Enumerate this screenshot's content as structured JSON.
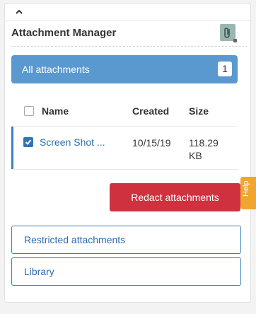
{
  "header": {
    "title": "Attachment Manager",
    "collapse_icon": "chevron-up-icon",
    "attach_icon": "paperclip-icon"
  },
  "all_attachments": {
    "label": "All attachments",
    "count": "1"
  },
  "table": {
    "columns": [
      "Name",
      "Created",
      "Size"
    ],
    "rows": [
      {
        "name": "Screen Shot ...",
        "created": "10/15/19",
        "size_line1": "118.29",
        "size_line2": "KB",
        "checked": true
      }
    ]
  },
  "actions": {
    "redact_label": "Redact attachments",
    "restricted_label": "Restricted attachments",
    "library_label": "Library",
    "help_label": "Help"
  },
  "colors": {
    "accent_blue": "#5a98d0",
    "link_blue": "#2b6cb0",
    "danger_red": "#d0313f",
    "help_orange": "#f0a531"
  }
}
